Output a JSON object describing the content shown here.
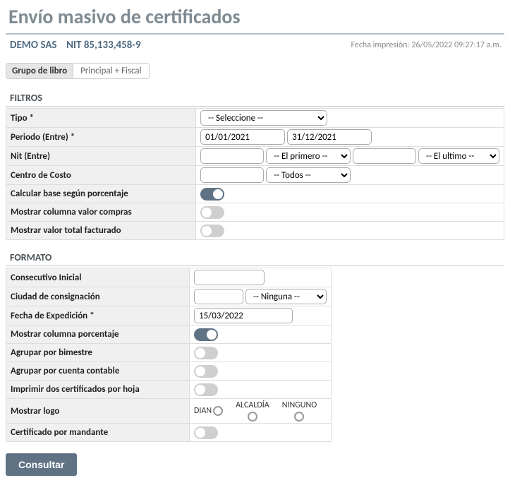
{
  "page_title": "Envío masivo de certificados",
  "company": {
    "name": "DEMO SAS",
    "nit_label": "NIT",
    "nit": "85,133,458-9"
  },
  "print_date": {
    "label": "Fecha impresión:",
    "value": "26/05/2022 09:27:17 a.m."
  },
  "book_group": {
    "label": "Grupo de libro",
    "value": "Principal + Fiscal"
  },
  "filters": {
    "title": "FILTROS",
    "tipo": {
      "label": "Tipo *",
      "selected": "-- Seleccione --"
    },
    "periodo": {
      "label": "Periodo (Entre) *",
      "from": "01/01/2021",
      "to": "31/12/2021"
    },
    "nit": {
      "label": "Nit (Entre)",
      "from": "",
      "to": "",
      "from_select": "-- El primero --",
      "to_select": "-- El ultimo --"
    },
    "centro_costo": {
      "label": "Centro de Costo",
      "value": "",
      "selected": "-- Todos --"
    },
    "calc_base": {
      "label": "Calcular base según porcentaje",
      "on": true
    },
    "col_compras": {
      "label": "Mostrar columna valor compras",
      "on": false
    },
    "val_facturado": {
      "label": "Mostrar valor total facturado",
      "on": false
    }
  },
  "formato": {
    "title": "FORMATO",
    "consecutivo": {
      "label": "Consecutivo Inicial",
      "value": ""
    },
    "ciudad": {
      "label": "Ciudad de consignación",
      "value": "",
      "selected": "-- Ninguna --"
    },
    "fecha_exp": {
      "label": "Fecha de Expedición *",
      "value": "15/03/2022"
    },
    "col_pct": {
      "label": "Mostrar columna porcentaje",
      "on": true
    },
    "agrupar_bim": {
      "label": "Agrupar por bimestre",
      "on": false
    },
    "agrupar_cuenta": {
      "label": "Agrupar por cuenta contable",
      "on": false
    },
    "dos_por_hoja": {
      "label": "Imprimir dos certificados por hoja",
      "on": false
    },
    "logo": {
      "label": "Mostrar logo",
      "options": {
        "dian": "DIAN",
        "alcaldia": "ALCALDÍA",
        "ninguno": "NINGUNO"
      }
    },
    "mandante": {
      "label": "Certificado por mandante",
      "on": false
    }
  },
  "actions": {
    "consultar": "Consultar"
  }
}
